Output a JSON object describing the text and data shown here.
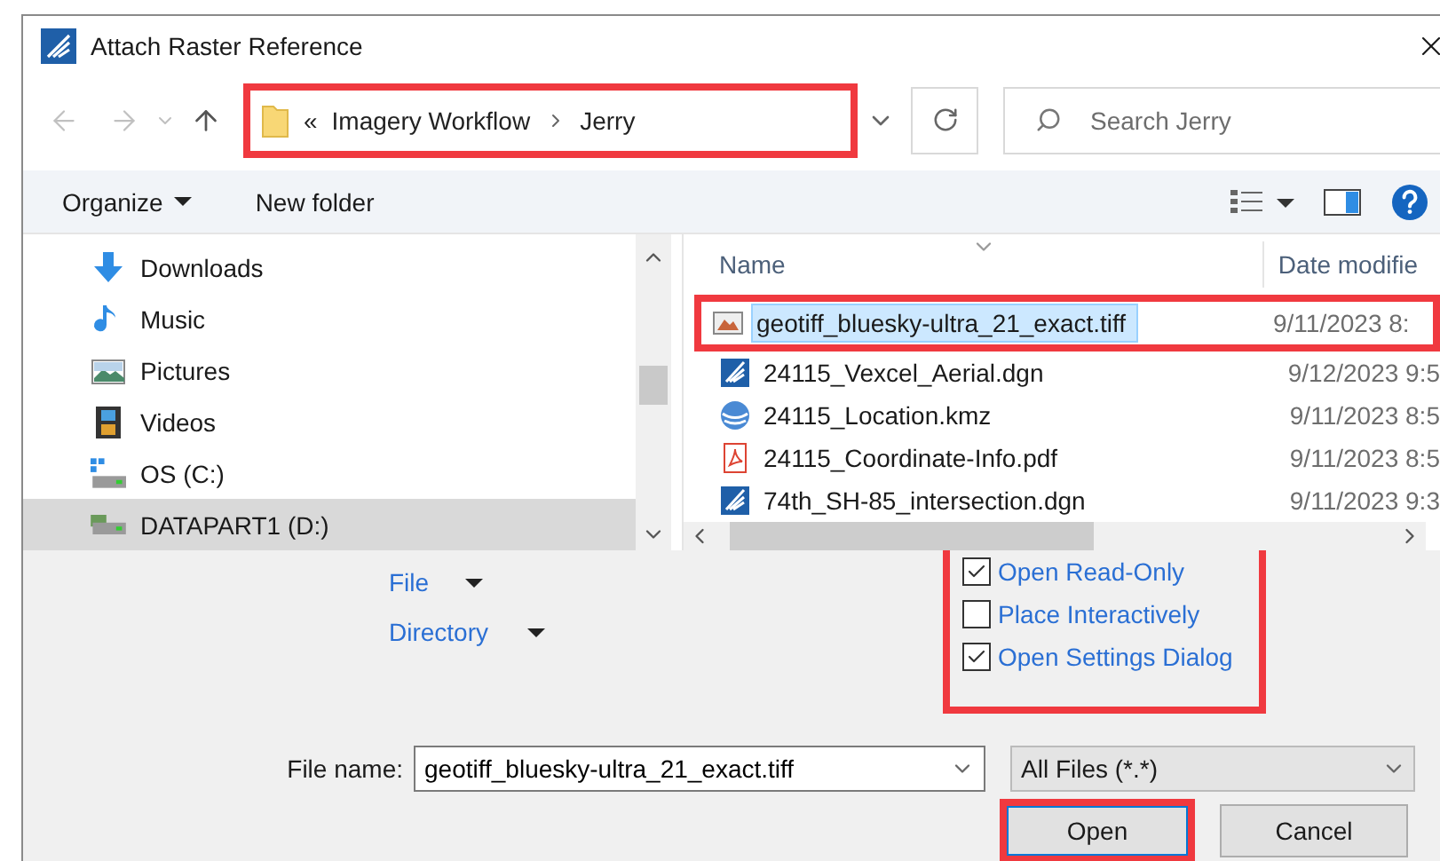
{
  "window": {
    "title": "Attach Raster Reference"
  },
  "address_bar": {
    "overflow": "«",
    "path": [
      {
        "label": "Imagery Workflow"
      },
      {
        "label": "Jerry"
      }
    ],
    "highlighted": true
  },
  "search": {
    "placeholder": "Search Jerry"
  },
  "toolbar": {
    "organize": "Organize",
    "new_folder": "New folder"
  },
  "nav_pane": {
    "items": [
      {
        "label": "Downloads",
        "kind": "downloads",
        "selected": false
      },
      {
        "label": "Music",
        "kind": "music",
        "selected": false
      },
      {
        "label": "Pictures",
        "kind": "pictures",
        "selected": false
      },
      {
        "label": "Videos",
        "kind": "videos",
        "selected": false
      },
      {
        "label": "OS (C:)",
        "kind": "os-drive",
        "selected": false
      },
      {
        "label": "DATAPART1 (D:)",
        "kind": "drive",
        "selected": true
      }
    ]
  },
  "file_list": {
    "columns": [
      "Name",
      "Date modifie"
    ],
    "rows": [
      {
        "name": "geotiff_bluesky-ultra_21_exact.tiff",
        "date": "9/11/2023 8:",
        "kind": "raster",
        "selected": true,
        "highlighted": true
      },
      {
        "name": "24115_Vexcel_Aerial.dgn",
        "date": "9/12/2023 9:5",
        "kind": "dgn",
        "selected": false,
        "highlighted": false
      },
      {
        "name": "24115_Location.kmz",
        "date": "9/11/2023 8:5",
        "kind": "kmz",
        "selected": false,
        "highlighted": false
      },
      {
        "name": "24115_Coordinate-Info.pdf",
        "date": "9/11/2023 8:5",
        "kind": "pdf",
        "selected": false,
        "highlighted": false
      },
      {
        "name": "74th_SH-85_intersection.dgn",
        "date": "9/11/2023 9:3",
        "kind": "dgn",
        "selected": false,
        "highlighted": false
      }
    ]
  },
  "options": {
    "file_label": "File",
    "directory_label": "Directory",
    "highlighted": true,
    "checkboxes": [
      {
        "label": "Open Read-Only",
        "checked": true
      },
      {
        "label": "Place Interactively",
        "checked": false
      },
      {
        "label": "Open Settings Dialog",
        "checked": true
      }
    ]
  },
  "file_name": {
    "label": "File name:",
    "value": "geotiff_bluesky-ultra_21_exact.tiff"
  },
  "file_type": {
    "value": "All Files (*.*)"
  },
  "buttons": [
    {
      "label": "Open",
      "highlighted": true
    },
    {
      "label": "Cancel",
      "highlighted": false
    }
  ]
}
